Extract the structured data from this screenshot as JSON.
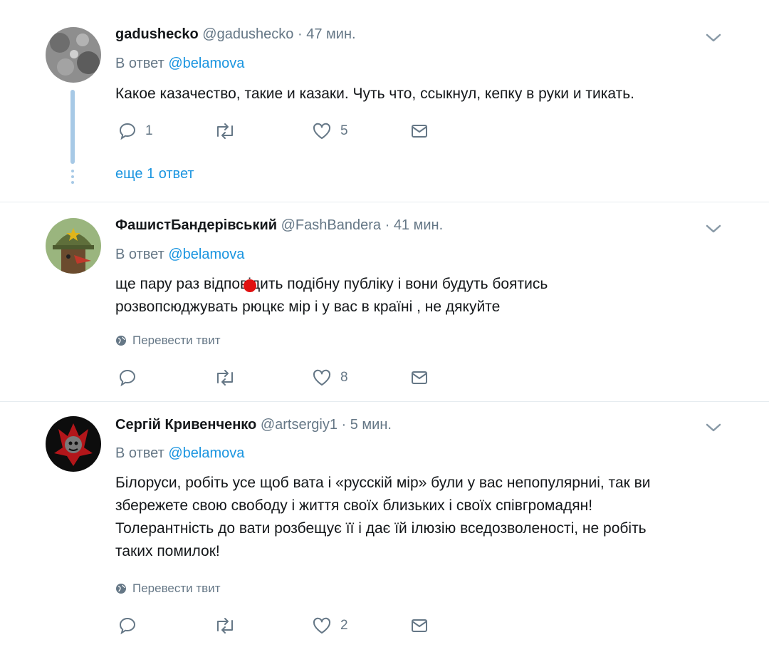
{
  "tweets": [
    {
      "name": "gadushecko",
      "handle": "@gadushecko",
      "time": "47 мин.",
      "reply_prefix": "В ответ",
      "reply_to": "@belamova",
      "text": "Какое казачество, такие и казаки. Чуть что, ссыкнул, кепку в руки и тикать.",
      "reply_count": "1",
      "retweet_count": "",
      "like_count": "5",
      "more_replies": "еще 1 ответ"
    },
    {
      "name": "ФашистБандерівський",
      "handle": "@FashBandera",
      "time": "41 мин.",
      "reply_prefix": "В ответ",
      "reply_to": "@belamova",
      "text": "ще пару раз відповідить подібну публіку і вони будуть боятись\nрозвопсюджувать рюцкє мір і у вас в країні , не дякуйте",
      "translate_label": "Перевести твит",
      "reply_count": "",
      "retweet_count": "",
      "like_count": "8"
    },
    {
      "name": "Сергій Кривенченко",
      "handle": "@artsergiy1",
      "time": "5 мин.",
      "reply_prefix": "В ответ",
      "reply_to": "@belamova",
      "text": "Білоруси, робіть усе щоб вата і «русскій мір» були у вас непопулярниі, так ви\nзбережете свою свободу і життя своїх близьких і своїх співгромадян!\nТолерантність до вати розбещує її і дає їй  ілюзію вседозволеності, не робіть\nтаких помилок!",
      "translate_label": "Перевести твит",
      "reply_count": "",
      "retweet_count": "",
      "like_count": "2"
    }
  ],
  "separator": "·",
  "colors": {
    "link": "#1b95e0",
    "muted": "#657786",
    "text": "#14171a",
    "thread_line": "#a7c9e6",
    "divider": "#e6ecf0"
  },
  "icons": [
    "reply-icon",
    "retweet-icon",
    "like-icon",
    "direct-message-icon",
    "chevron-down-icon",
    "globe-icon"
  ]
}
